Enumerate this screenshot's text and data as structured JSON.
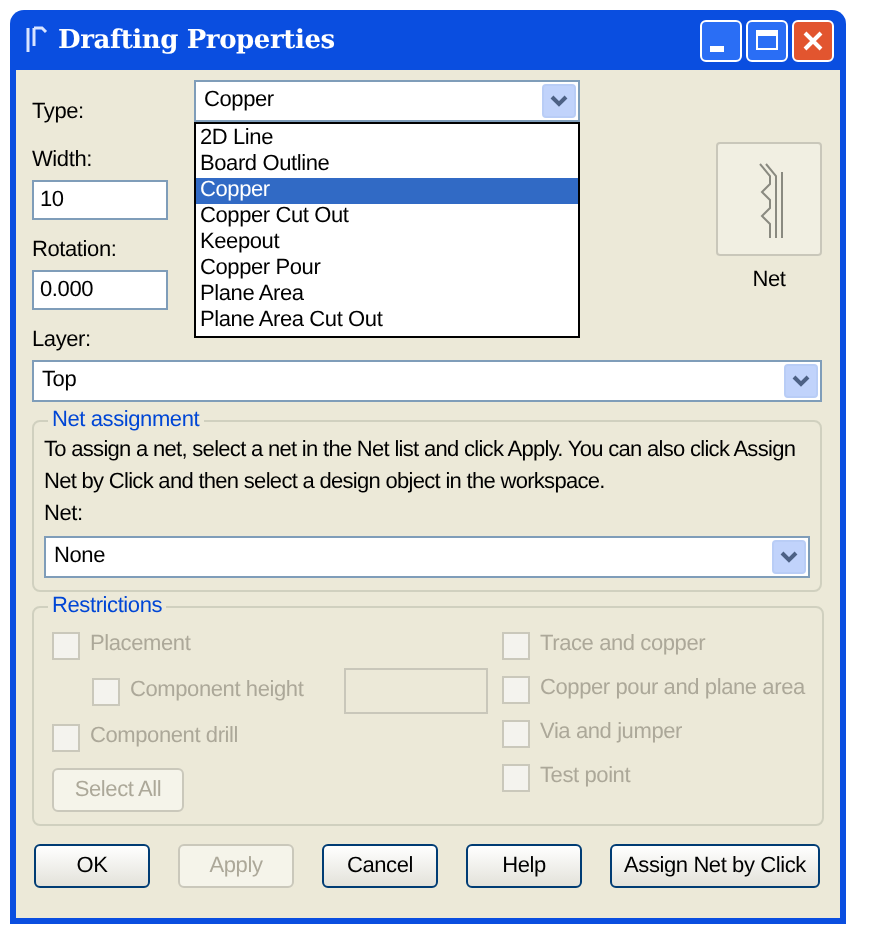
{
  "window": {
    "title": "Drafting Properties"
  },
  "type_field": {
    "label": "Type:",
    "value": "Copper",
    "expanded": true,
    "options": [
      {
        "label": "2D Line",
        "selected": false
      },
      {
        "label": "Board Outline",
        "selected": false
      },
      {
        "label": "Copper",
        "selected": true
      },
      {
        "label": "Copper Cut Out",
        "selected": false
      },
      {
        "label": "Keepout",
        "selected": false
      },
      {
        "label": "Copper Pour",
        "selected": false
      },
      {
        "label": "Plane Area",
        "selected": false
      },
      {
        "label": "Plane Area Cut Out",
        "selected": false
      }
    ]
  },
  "width_field": {
    "label": "Width:",
    "value": "10"
  },
  "rotation_field": {
    "label": "Rotation:",
    "value": "0.000"
  },
  "net_button": {
    "label": "Net"
  },
  "layer_field": {
    "label": "Layer:",
    "value": "Top"
  },
  "net_assignment": {
    "title": "Net assignment",
    "description": "To assign a net, select a net in the Net list and click Apply. You can also click Assign Net by Click and then select a design object in the workspace.",
    "net_label": "Net:",
    "net_value": "None"
  },
  "restrictions": {
    "title": "Restrictions",
    "left": [
      {
        "label": "Placement",
        "checked": false,
        "disabled": true,
        "children": [
          {
            "label": "Component height",
            "checked": false,
            "disabled": true
          }
        ]
      },
      {
        "label": "Component drill",
        "checked": false,
        "disabled": true
      }
    ],
    "select_all": {
      "label": "Select All",
      "disabled": true
    },
    "right": [
      {
        "label": "Trace and copper",
        "checked": false,
        "disabled": true
      },
      {
        "label": "Copper pour and plane area",
        "checked": false,
        "disabled": true
      },
      {
        "label": "Via and jumper",
        "checked": false,
        "disabled": true
      },
      {
        "label": "Test point",
        "checked": false,
        "disabled": true
      }
    ]
  },
  "buttons": [
    {
      "label": "OK",
      "disabled": false
    },
    {
      "label": "Apply",
      "disabled": true
    },
    {
      "label": "Cancel",
      "disabled": false
    },
    {
      "label": "Help",
      "disabled": false
    },
    {
      "label": "Assign Net by Click",
      "disabled": false
    }
  ]
}
